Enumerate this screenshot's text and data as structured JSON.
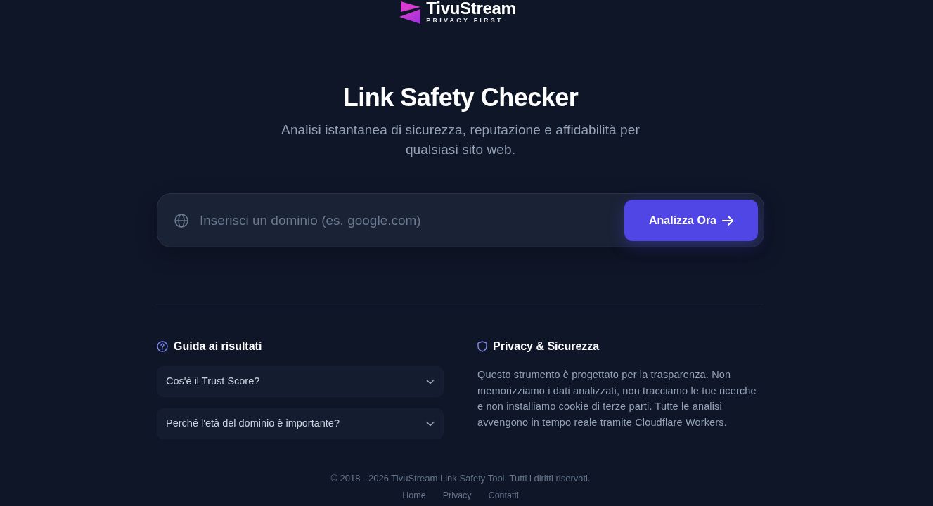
{
  "logo": {
    "name": "TivuStream",
    "tagline": "PRIVACY FIRST"
  },
  "hero": {
    "title": "Link Safety Checker",
    "subtitle": "Analisi istantanea di sicurezza, reputazione e affidabilità per qualsiasi sito web."
  },
  "search": {
    "placeholder": "Inserisci un dominio (es. google.com)",
    "button": "Analizza Ora"
  },
  "guide": {
    "title": "Guida ai risultati",
    "items": [
      {
        "question": "Cos'è il Trust Score?",
        "expanded": false
      },
      {
        "question": "Perché l'età del dominio è importante?",
        "expanded": false
      }
    ]
  },
  "privacy": {
    "title": "Privacy & Sicurezza",
    "text": "Questo strumento è progettato per la trasparenza. Non memorizziamo i dati analizzati, non tracciamo le tue ricerche e non installiamo cookie di terze parti. Tutte le analisi avvengono in tempo reale tramite Cloudflare Workers."
  },
  "footer": {
    "copyright": "© 2018 - 2026 TivuStream Link Safety Tool. Tutti i diritti riservati.",
    "links": [
      "Home",
      "Privacy",
      "Contatti"
    ]
  }
}
